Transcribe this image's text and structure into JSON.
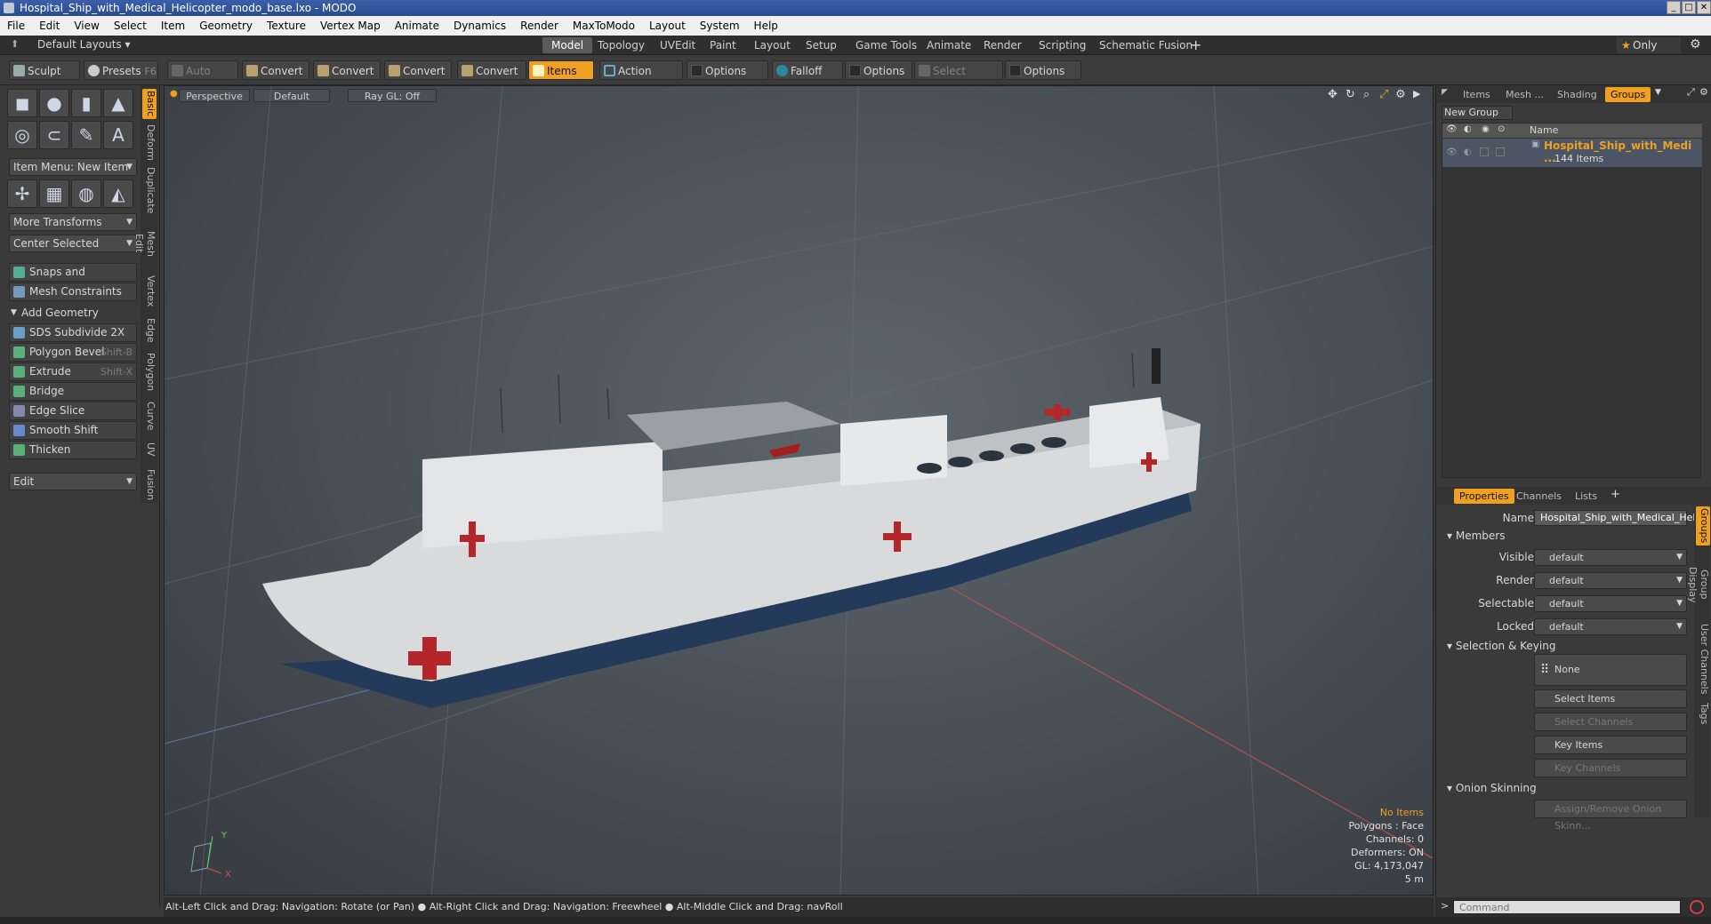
{
  "window": {
    "title": "Hospital_Ship_with_Medical_Helicopter_modo_base.lxo - MODO"
  },
  "menu": [
    "File",
    "Edit",
    "View",
    "Select",
    "Item",
    "Geometry",
    "Texture",
    "Vertex Map",
    "Animate",
    "Dynamics",
    "Render",
    "MaxToModo",
    "Layout",
    "System",
    "Help"
  ],
  "layoutbar": {
    "preset": "Default Layouts",
    "tabs": [
      "Model",
      "Topology",
      "UVEdit",
      "Paint",
      "Layout",
      "Setup",
      "Game Tools",
      "Animate",
      "Render",
      "Scripting",
      "Schematic Fusion"
    ],
    "active_tab": "Model",
    "only_label": "Only"
  },
  "toolrow": {
    "sculpt": "Sculpt",
    "presets": "Presets",
    "presets_key": "F6",
    "auto_select": "Auto Select",
    "convert": "Convert",
    "items": "Items",
    "action_center": "Action Center",
    "options": "Options",
    "falloff": "Falloff",
    "select_through": "Select Through"
  },
  "left": {
    "item_menu": "Item Menu: New Item",
    "more_transforms": "More Transforms",
    "center_selected": "Center Selected",
    "snaps": "Snaps and Precision",
    "mesh_constraints": "Mesh Constraints",
    "add_geometry": "Add Geometry",
    "tools": [
      {
        "label": "SDS Subdivide 2X",
        "key": ""
      },
      {
        "label": "Polygon Bevel",
        "key": "Shift-B"
      },
      {
        "label": "Extrude",
        "key": "Shift-X"
      },
      {
        "label": "Bridge",
        "key": ""
      },
      {
        "label": "Edge Slice",
        "key": ""
      },
      {
        "label": "Smooth Shift",
        "key": ""
      },
      {
        "label": "Thicken",
        "key": ""
      }
    ],
    "edit": "Edit",
    "vtabs": [
      "Basic",
      "Deform",
      "Duplicate",
      "Mesh Edit",
      "Vertex",
      "Edge",
      "Polygon",
      "Curve",
      "UV",
      "Fusion"
    ]
  },
  "viewport": {
    "view": "Perspective",
    "shading": "Default",
    "raygl": "Ray GL: Off",
    "stats": {
      "no_items": "No Items",
      "polygons": "Polygons : Face",
      "channels": "Channels: 0",
      "deformers": "Deformers: ON",
      "gl": "GL: 4,173,047",
      "scale": "5 m"
    },
    "axis": {
      "y": "Y",
      "x": "X"
    }
  },
  "right": {
    "tabs": [
      "Items",
      "Mesh ...",
      "Shading",
      "Groups"
    ],
    "active_tab": "Groups",
    "new_group": "New Group",
    "col_name": "Name",
    "group_name": "Hospital_Ship_with_Medi ...",
    "group_count": "144 Items",
    "prop_tabs": [
      "Properties",
      "Channels",
      "Lists"
    ],
    "name_label": "Name",
    "name_value": "Hospital_Ship_with_Medical_Helic",
    "members": "Members",
    "visible_label": "Visible",
    "render_label": "Render",
    "selectable_label": "Selectable",
    "locked_label": "Locked",
    "default_value": "default",
    "selection_keying": "Selection & Keying",
    "none": "None",
    "select_items": "Select Items",
    "select_channels": "Select Channels",
    "key_items": "Key Items",
    "key_channels": "Key Channels",
    "onion": "Onion Skinning",
    "onion_btn": "Assign/Remove Onion Skinn...",
    "side_tabs": [
      "Groups",
      "Group Display",
      "User Channels",
      "Tags"
    ]
  },
  "status": {
    "hint1": "Alt-Left Click and Drag: Navigation: Rotate (or Pan)",
    "hint2": "Alt-Right Click and Drag: Navigation: Freewheel",
    "hint3": "Alt-Middle Click and Drag: navRoll",
    "command_placeholder": "Command"
  }
}
